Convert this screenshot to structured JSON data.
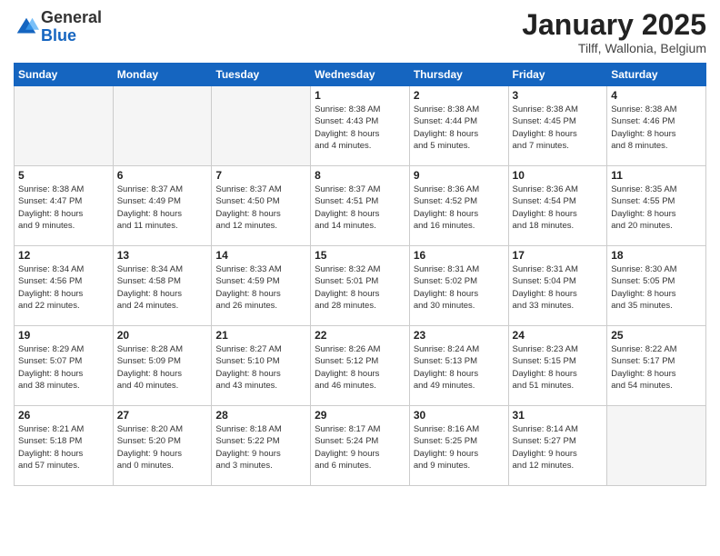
{
  "logo": {
    "general": "General",
    "blue": "Blue"
  },
  "title": "January 2025",
  "location": "Tilff, Wallonia, Belgium",
  "days_of_week": [
    "Sunday",
    "Monday",
    "Tuesday",
    "Wednesday",
    "Thursday",
    "Friday",
    "Saturday"
  ],
  "weeks": [
    [
      {
        "day": "",
        "info": ""
      },
      {
        "day": "",
        "info": ""
      },
      {
        "day": "",
        "info": ""
      },
      {
        "day": "1",
        "info": "Sunrise: 8:38 AM\nSunset: 4:43 PM\nDaylight: 8 hours\nand 4 minutes."
      },
      {
        "day": "2",
        "info": "Sunrise: 8:38 AM\nSunset: 4:44 PM\nDaylight: 8 hours\nand 5 minutes."
      },
      {
        "day": "3",
        "info": "Sunrise: 8:38 AM\nSunset: 4:45 PM\nDaylight: 8 hours\nand 7 minutes."
      },
      {
        "day": "4",
        "info": "Sunrise: 8:38 AM\nSunset: 4:46 PM\nDaylight: 8 hours\nand 8 minutes."
      }
    ],
    [
      {
        "day": "5",
        "info": "Sunrise: 8:38 AM\nSunset: 4:47 PM\nDaylight: 8 hours\nand 9 minutes."
      },
      {
        "day": "6",
        "info": "Sunrise: 8:37 AM\nSunset: 4:49 PM\nDaylight: 8 hours\nand 11 minutes."
      },
      {
        "day": "7",
        "info": "Sunrise: 8:37 AM\nSunset: 4:50 PM\nDaylight: 8 hours\nand 12 minutes."
      },
      {
        "day": "8",
        "info": "Sunrise: 8:37 AM\nSunset: 4:51 PM\nDaylight: 8 hours\nand 14 minutes."
      },
      {
        "day": "9",
        "info": "Sunrise: 8:36 AM\nSunset: 4:52 PM\nDaylight: 8 hours\nand 16 minutes."
      },
      {
        "day": "10",
        "info": "Sunrise: 8:36 AM\nSunset: 4:54 PM\nDaylight: 8 hours\nand 18 minutes."
      },
      {
        "day": "11",
        "info": "Sunrise: 8:35 AM\nSunset: 4:55 PM\nDaylight: 8 hours\nand 20 minutes."
      }
    ],
    [
      {
        "day": "12",
        "info": "Sunrise: 8:34 AM\nSunset: 4:56 PM\nDaylight: 8 hours\nand 22 minutes."
      },
      {
        "day": "13",
        "info": "Sunrise: 8:34 AM\nSunset: 4:58 PM\nDaylight: 8 hours\nand 24 minutes."
      },
      {
        "day": "14",
        "info": "Sunrise: 8:33 AM\nSunset: 4:59 PM\nDaylight: 8 hours\nand 26 minutes."
      },
      {
        "day": "15",
        "info": "Sunrise: 8:32 AM\nSunset: 5:01 PM\nDaylight: 8 hours\nand 28 minutes."
      },
      {
        "day": "16",
        "info": "Sunrise: 8:31 AM\nSunset: 5:02 PM\nDaylight: 8 hours\nand 30 minutes."
      },
      {
        "day": "17",
        "info": "Sunrise: 8:31 AM\nSunset: 5:04 PM\nDaylight: 8 hours\nand 33 minutes."
      },
      {
        "day": "18",
        "info": "Sunrise: 8:30 AM\nSunset: 5:05 PM\nDaylight: 8 hours\nand 35 minutes."
      }
    ],
    [
      {
        "day": "19",
        "info": "Sunrise: 8:29 AM\nSunset: 5:07 PM\nDaylight: 8 hours\nand 38 minutes."
      },
      {
        "day": "20",
        "info": "Sunrise: 8:28 AM\nSunset: 5:09 PM\nDaylight: 8 hours\nand 40 minutes."
      },
      {
        "day": "21",
        "info": "Sunrise: 8:27 AM\nSunset: 5:10 PM\nDaylight: 8 hours\nand 43 minutes."
      },
      {
        "day": "22",
        "info": "Sunrise: 8:26 AM\nSunset: 5:12 PM\nDaylight: 8 hours\nand 46 minutes."
      },
      {
        "day": "23",
        "info": "Sunrise: 8:24 AM\nSunset: 5:13 PM\nDaylight: 8 hours\nand 49 minutes."
      },
      {
        "day": "24",
        "info": "Sunrise: 8:23 AM\nSunset: 5:15 PM\nDaylight: 8 hours\nand 51 minutes."
      },
      {
        "day": "25",
        "info": "Sunrise: 8:22 AM\nSunset: 5:17 PM\nDaylight: 8 hours\nand 54 minutes."
      }
    ],
    [
      {
        "day": "26",
        "info": "Sunrise: 8:21 AM\nSunset: 5:18 PM\nDaylight: 8 hours\nand 57 minutes."
      },
      {
        "day": "27",
        "info": "Sunrise: 8:20 AM\nSunset: 5:20 PM\nDaylight: 9 hours\nand 0 minutes."
      },
      {
        "day": "28",
        "info": "Sunrise: 8:18 AM\nSunset: 5:22 PM\nDaylight: 9 hours\nand 3 minutes."
      },
      {
        "day": "29",
        "info": "Sunrise: 8:17 AM\nSunset: 5:24 PM\nDaylight: 9 hours\nand 6 minutes."
      },
      {
        "day": "30",
        "info": "Sunrise: 8:16 AM\nSunset: 5:25 PM\nDaylight: 9 hours\nand 9 minutes."
      },
      {
        "day": "31",
        "info": "Sunrise: 8:14 AM\nSunset: 5:27 PM\nDaylight: 9 hours\nand 12 minutes."
      },
      {
        "day": "",
        "info": ""
      }
    ]
  ]
}
